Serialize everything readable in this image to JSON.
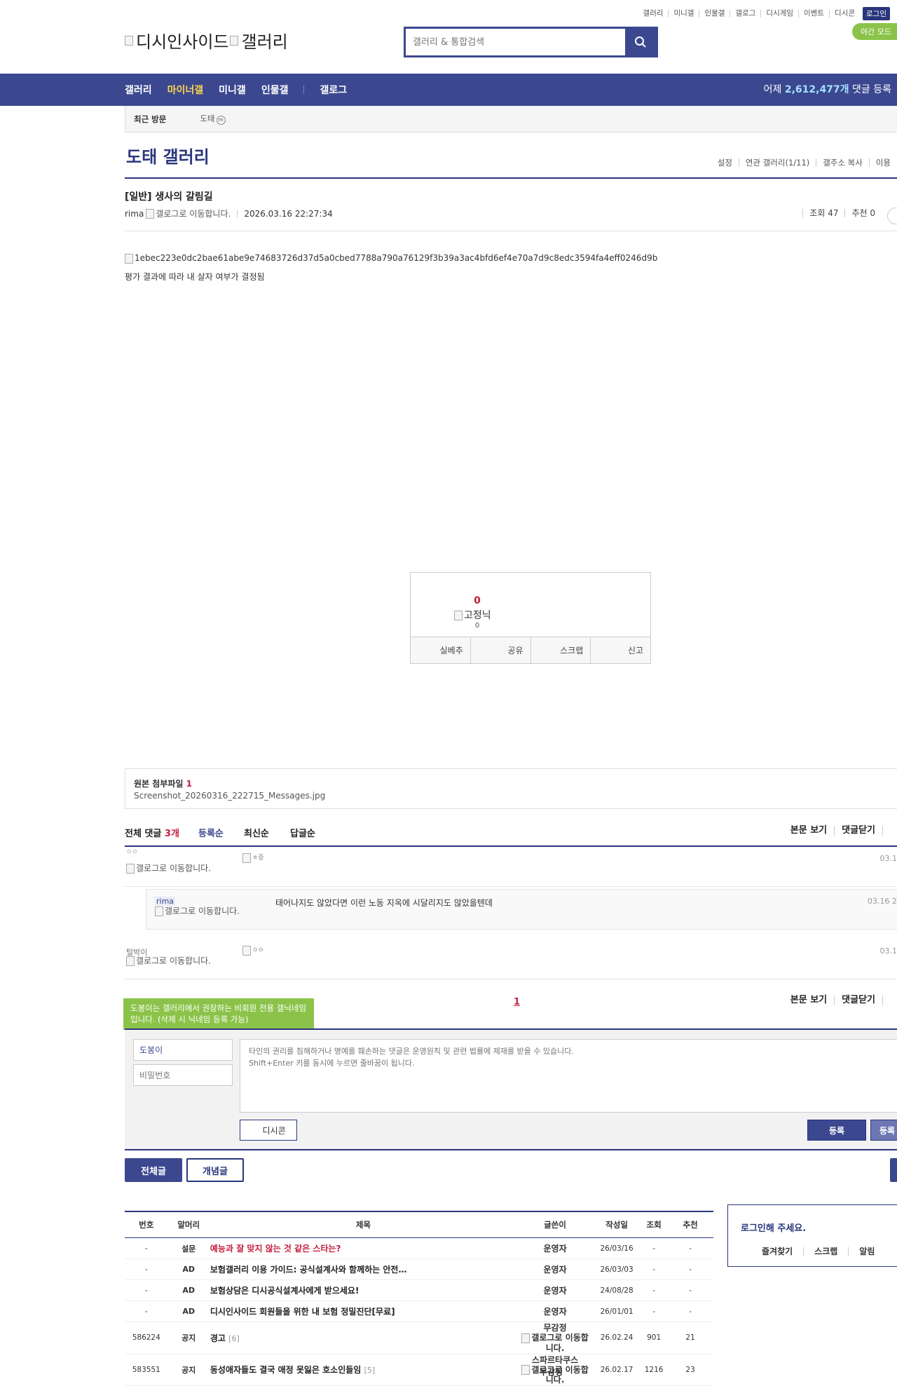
{
  "top_menu": [
    "갤러리",
    "미니갤",
    "인물갤",
    "갤로그",
    "디시게임",
    "이벤트",
    "디시콘"
  ],
  "login_label": "로그인",
  "night_label": "야간 모드",
  "logo": {
    "dc_alt": "디시인사이드",
    "gallery_alt": "갤러리"
  },
  "search": {
    "placeholder": "갤러리 & 통합검색",
    "icon": "search-icon"
  },
  "gnb": {
    "items": [
      "갤러리",
      "마이너갤",
      "미니갤",
      "인물갤",
      "갤로그"
    ],
    "active": "마이너갤",
    "yesterday_prefix": "어제",
    "yesterday_count": "2,612,477개",
    "yesterday_suffix": "댓글 등록"
  },
  "recent": {
    "label": "최근 방문",
    "item": "도태",
    "item_badge": "m"
  },
  "gallery": {
    "title": "도태 갤러리",
    "links": [
      "설정",
      "연관 갤러리(1/11)",
      "갤주소 복사",
      "이용"
    ]
  },
  "post": {
    "title": "[일반] 생사의 갈림길",
    "author": "rima",
    "author_icon_alt": "갤로그로 이동합니다.",
    "date": "2026.03.16 22:27:34",
    "views": "조회 47",
    "recommends": "추천 0",
    "image_alt": "1ebec223e0dc2bae61abe9e74683726d37d5a0cbed7788a790a76129f3b39a3ac4bfd6ef4e70a7d9c8edc3594fa4eff0246d9b",
    "body_text": "평가 결과에 따라 내 살자 여부가 결정됨"
  },
  "recommend_box": {
    "count": "0",
    "fixed_alt": "고정닉",
    "fixed_count": "0",
    "buttons": [
      "실베추",
      "공유",
      "스크랩",
      "신고"
    ]
  },
  "attachment": {
    "label": "원본 첨부파일",
    "count": "1",
    "filename": "Screenshot_20260316_222715_Messages.jpg"
  },
  "comments": {
    "total_label": "전체 댓글",
    "total_count": "3개",
    "sort": [
      "등록순",
      "최신순",
      "답글순"
    ],
    "right_links": [
      "본문 보기",
      "댓글닫기"
    ],
    "items": [
      {
        "nick": "ㅇㅇ",
        "icon_alt": "갤로그로 이동합니다.",
        "text_alt": "ㅎ중",
        "date": "03.1"
      },
      {
        "nick": "rima",
        "icon_alt": "갤로그로 이동합니다.",
        "text": "태어나지도 않았다면 이런 노동 지옥에 시달리지도 않았을텐데",
        "date": "03.16 2"
      },
      {
        "nick": "털박이",
        "icon_alt": "갤로그로 이동합니다.",
        "text_alt": "ㅇㅇ",
        "date": "03.1"
      }
    ],
    "page": "1",
    "tooltip": "도봉이는 갤러리에서 권장하는 비회원 전용 갤닉네임입니다. (삭제 시 닉네임 등록 가능)",
    "nick_value": "도봉이",
    "pw_placeholder": "비밀번호",
    "textarea_placeholder": "타인의 권리를 침해하거나 명예를 훼손하는 댓글은 운영원칙 및 관련 법률에 제재를 받을 수 있습니다.\nShift+Enter 키를 동시에 누르면 줄바꿈이 됩니다.",
    "dccon_label": "디시콘",
    "submit_label": "등록",
    "submit2_label": "등록"
  },
  "list_tabs": [
    "전체글",
    "개념글"
  ],
  "list": {
    "headers": [
      "번호",
      "말머리",
      "제목",
      "글쓴이",
      "작성일",
      "조회",
      "추천"
    ],
    "rows": [
      {
        "num": "-",
        "head": "설문",
        "title": "예능과 잘 맞지 않는 것 같은 스타는?",
        "writer": "운영자",
        "date": "26/03/16",
        "views": "-",
        "rec": "-",
        "red": true
      },
      {
        "num": "-",
        "head": "AD",
        "title": "보험갤러리 이용 가이드: 공식설계사와 함께하는 안전…",
        "writer": "운영자",
        "date": "26/03/03",
        "views": "-",
        "rec": "-"
      },
      {
        "num": "-",
        "head": "AD",
        "title": "보험상담은 디시공식설계사에게 받으세요!",
        "writer": "운영자",
        "date": "24/08/28",
        "views": "-",
        "rec": "-"
      },
      {
        "num": "-",
        "head": "AD",
        "title": "디시인사이드 회원들을 위한 내 보험 정밀진단[무료]",
        "writer": "운영자",
        "date": "26/01/01",
        "views": "-",
        "rec": "-"
      },
      {
        "num": "586224",
        "head": "공지",
        "title": "경고",
        "reply": "[6]",
        "writer": "무감정",
        "writer_icon_alt": "갤로그로 이동합니다.",
        "date": "26.02.24",
        "views": "901",
        "rec": "21"
      },
      {
        "num": "583551",
        "head": "공지",
        "title": "동성애자들도 결국 애정 못잃은 호소인들임",
        "reply": "[5]",
        "writer": "스파르타쿠스",
        "writer_icon_alt": "갤로그로 이동합니다.",
        "date": "26.02.17",
        "views": "1216",
        "rec": "23"
      }
    ],
    "next_writer": "무감정"
  },
  "loginbox": {
    "title": "로그인해 주세요.",
    "menu": [
      "즐겨찾기",
      "스크랩",
      "알림"
    ]
  },
  "colors": {
    "brand": "#3b4890",
    "brand_dark": "#29367c",
    "accent_red": "#c41e3a",
    "green": "#8bc34a",
    "active_nav": "#ffd34c"
  }
}
